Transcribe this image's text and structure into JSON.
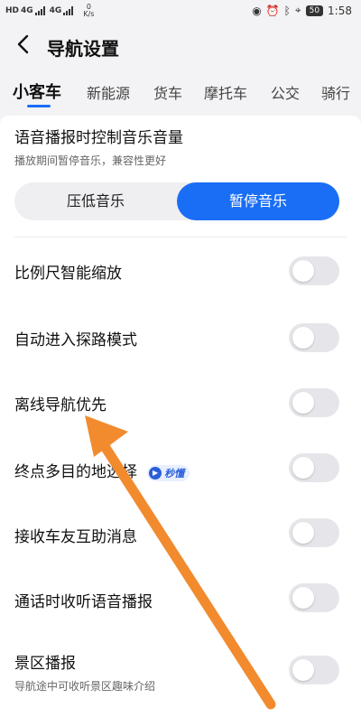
{
  "status_bar": {
    "left_indicators": [
      "HD",
      "4G",
      "4G"
    ],
    "speed_value": "0",
    "speed_unit": "K/s",
    "battery": "50",
    "time": "1:58",
    "icons": [
      "eye-icon",
      "alarm-icon",
      "bluetooth-icon",
      "location-icon"
    ]
  },
  "header": {
    "title": "导航设置",
    "back_icon": "chevron-left-icon"
  },
  "tabs": [
    {
      "label": "小客车",
      "active": true
    },
    {
      "label": "新能源",
      "active": false
    },
    {
      "label": "货车",
      "active": false
    },
    {
      "label": "摩托车",
      "active": false
    },
    {
      "label": "公交",
      "active": false
    },
    {
      "label": "骑行",
      "active": false
    }
  ],
  "voice_control": {
    "title": "语音播报时控制音乐音量",
    "subtitle": "播放期间暂停音乐，兼容性更好",
    "options": [
      "压低音乐",
      "暂停音乐"
    ],
    "selected": "暂停音乐"
  },
  "settings": [
    {
      "label": "比例尺智能缩放",
      "enabled": false
    },
    {
      "label": "自动进入探路模式",
      "enabled": false
    },
    {
      "label": "离线导航优先",
      "enabled": false
    },
    {
      "label": "终点多目的地选择",
      "enabled": false,
      "badge": "秒懂"
    },
    {
      "label": "接收车友互助消息",
      "enabled": false
    },
    {
      "label": "通话时收听语音播报",
      "enabled": false
    },
    {
      "label": "景区播报",
      "subtitle": "导航途中可收听景区趣味介绍",
      "enabled": false
    }
  ],
  "colors": {
    "accent": "#1a6ef5",
    "arrow": "#f28a2e",
    "toggle_off": "#e6e6ea"
  }
}
